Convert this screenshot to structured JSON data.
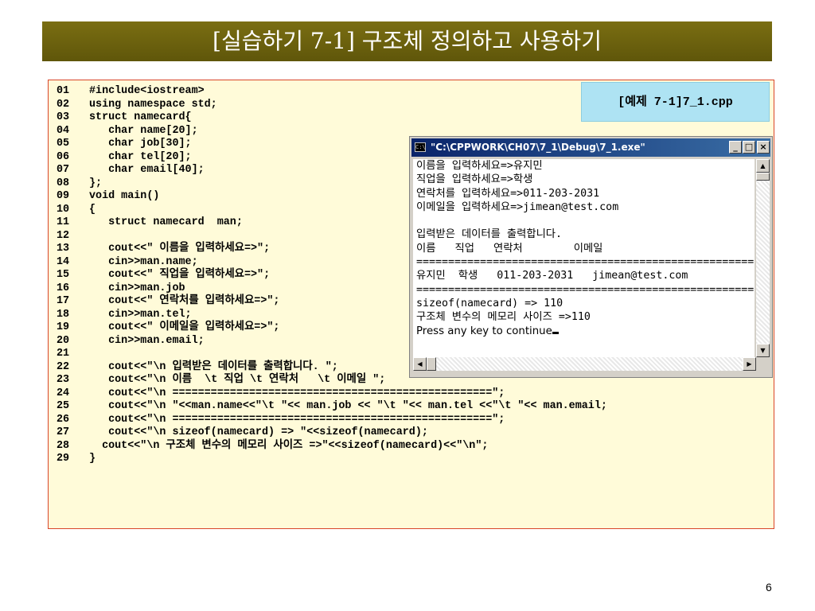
{
  "slide": {
    "title": "[실습하기 7-1] 구조체 정의하고 사용하기",
    "page_number": "6",
    "example_label": "[예제 7-1]7_1.cpp",
    "colors": {
      "title_bg": "#6b620e",
      "code_bg": "#fffbd9",
      "code_border": "#d9462a",
      "label_bg": "#aee3f3"
    }
  },
  "code": {
    "lines": [
      {
        "num": "01",
        "text": "#include<iostream>"
      },
      {
        "num": "02",
        "text": "using namespace std;"
      },
      {
        "num": "03",
        "text": "struct namecard{"
      },
      {
        "num": "04",
        "text": "   char name[20];"
      },
      {
        "num": "05",
        "text": "   char job[30];"
      },
      {
        "num": "06",
        "text": "   char tel[20];"
      },
      {
        "num": "07",
        "text": "   char email[40];"
      },
      {
        "num": "08",
        "text": "};"
      },
      {
        "num": "09",
        "text": "void main()"
      },
      {
        "num": "10",
        "text": "{"
      },
      {
        "num": "11",
        "text": "   struct namecard  man;"
      },
      {
        "num": "12",
        "text": ""
      },
      {
        "num": "13",
        "text": "   cout<<\" 이름을 입력하세요=>\";"
      },
      {
        "num": "14",
        "text": "   cin>>man.name;"
      },
      {
        "num": "15",
        "text": "   cout<<\" 직업을 입력하세요=>\";"
      },
      {
        "num": "16",
        "text": "   cin>>man.job"
      },
      {
        "num": "17",
        "text": "   cout<<\" 연락처를 입력하세요=>\";"
      },
      {
        "num": "18",
        "text": "   cin>>man.tel;"
      },
      {
        "num": "19",
        "text": "   cout<<\" 이메일을 입력하세요=>\";"
      },
      {
        "num": "20",
        "text": "   cin>>man.email;"
      },
      {
        "num": "21",
        "text": ""
      },
      {
        "num": "22",
        "text": "   cout<<\"\\n 입력받은 데이터를 출력합니다. \";"
      },
      {
        "num": "23",
        "text": "   cout<<\"\\n 이름  \\t 직업 \\t 연락처   \\t 이메일 \";"
      },
      {
        "num": "24",
        "text": "   cout<<\"\\n ==================================================\";"
      },
      {
        "num": "25",
        "text": "   cout<<\"\\n \"<<man.name<<\"\\t \"<< man.job << \"\\t \"<< man.tel <<\"\\t \"<< man.email;"
      },
      {
        "num": "26",
        "text": "   cout<<\"\\n ==================================================\";"
      },
      {
        "num": "27",
        "text": "   cout<<\"\\n sizeof(namecard) => \"<<sizeof(namecard);"
      },
      {
        "num": "28",
        "text": "  cout<<\"\\n 구조체 변수의 메모리 사이즈 =>\"<<sizeof(namecard)<<\"\\n\";"
      },
      {
        "num": "29",
        "text": "}"
      }
    ]
  },
  "console": {
    "window_title": "\"C:\\CPPWORK\\CH07\\7_1\\Debug\\7_1.exe\"",
    "window_icon": "console-window-icon",
    "buttons": {
      "minimize": "_",
      "maximize": "□",
      "close": "×"
    },
    "lines": [
      "이름을 입력하세요=>유지민",
      "직업을 입력하세요=>학생",
      "연락처를 입력하세요=>011-203-2031",
      "이메일을 입력하세요=>jimean@test.com",
      "",
      "입력받은 데이터를 출력합니다.",
      "이름   직업   연락처        이메일",
      "=====================================================",
      "유지민  학생   011-203-2031   jimean@test.com",
      "=====================================================",
      "sizeof(namecard) => 110",
      "구조체 변수의 메모리 사이즈 =>110"
    ],
    "last_line": "Press any key to continue"
  }
}
